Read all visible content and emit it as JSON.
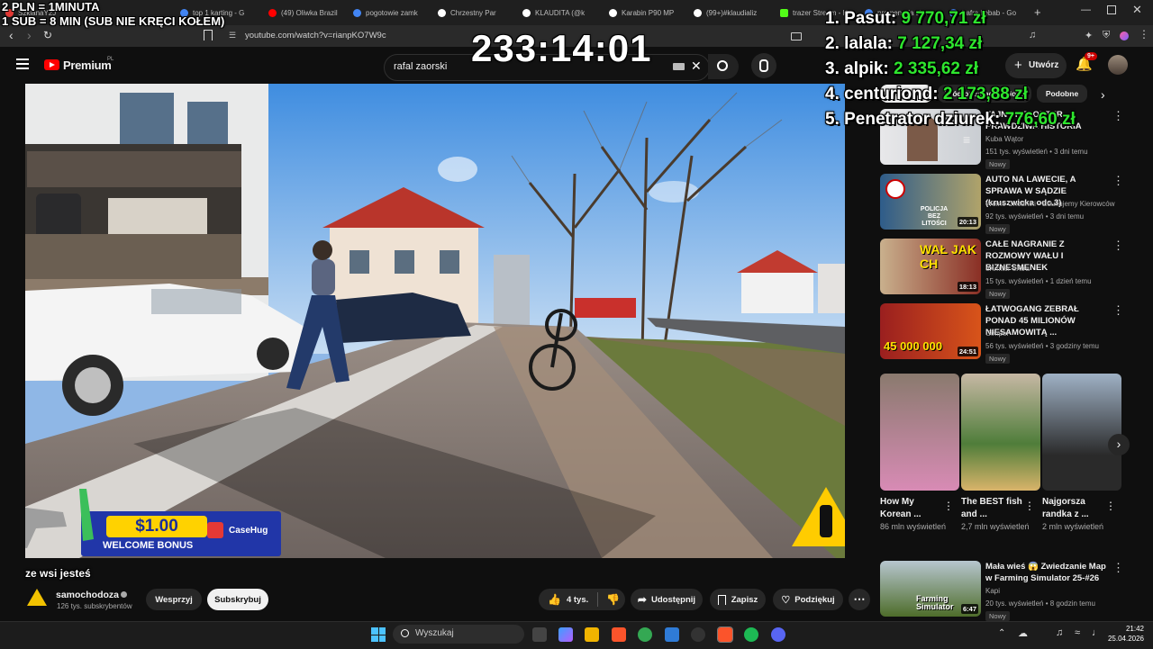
{
  "overlay": {
    "rate_line1": "2 PLN = 1MINUTA",
    "rate_line2": "1 SUB = 8 MIN (SUB NIE KRĘCI KOŁEM)",
    "timer": "233:14:01",
    "leaderboard": [
      {
        "name": "1. Pasut: ",
        "amount": "9 770,71 zł"
      },
      {
        "name": "2. lalala: ",
        "amount": "7 127,34 zł"
      },
      {
        "name": "3. alpik: ",
        "amount": "2 335,62 zł"
      },
      {
        "name": "4. centuriond: ",
        "amount": "2 173,88 zł"
      },
      {
        "name": "5. Penetrator dziurek: ",
        "amount": "776,60 zł"
      }
    ],
    "promo_amount": "$1.00",
    "promo_text": "WELCOME BONUS",
    "promo_brand": "CaseHug",
    "caption": "ze wsi jesteś"
  },
  "browser": {
    "tabs": [
      {
        "label": "SzklanaY2J",
        "color": "#e53935"
      },
      {
        "label": "top 1 karting - G",
        "color": "#4285f4"
      },
      {
        "label": "(49) Oliwka Brazil",
        "color": "#ff0000"
      },
      {
        "label": "pogotowie zamk",
        "color": "#4285f4"
      },
      {
        "label": "Chrzestny Par",
        "color": "#ffffff"
      },
      {
        "label": "KLAUDITA (@k",
        "color": "#ffffff"
      },
      {
        "label": "Karabin P90 MP",
        "color": "#ffffff"
      },
      {
        "label": "(99+)#klaudializ",
        "color": "#ffffff"
      },
      {
        "label": "trazer Stream - K",
        "color": "#53fc18"
      },
      {
        "label": "promenada sko",
        "color": "#4285f4"
      },
      {
        "label": "bafra kebab - Go",
        "color": "#4285f4"
      }
    ],
    "new_tab": "+",
    "url": "youtube.com/watch?v=rianpKO7W9c"
  },
  "youtube": {
    "logo": "Premium",
    "logo_region": "PL",
    "search_value": "rafal zaorski",
    "create_label": "Utwórz",
    "notif_count": "9+",
    "chips": [
      "Wszystko",
      "Źródło: samochodoza",
      "Podobne"
    ],
    "channel": {
      "name": "samochodoza",
      "subs": "126 tys. subskrybentów"
    },
    "actions": {
      "support": "Wesprzyj",
      "subscribe": "Subskrybuj",
      "likes": "4 tys.",
      "share": "Udostępnij",
      "save": "Zapisz",
      "thanks": "Podziękuj"
    },
    "recommended": [
      {
        "title": "TAJNY REPORTER PRAWDZIWA HISTORIA",
        "channel": "Kuba Wątor",
        "meta": "151 tys. wyświetleń • 3 dni temu",
        "badge": "Nowy",
        "duration": ""
      },
      {
        "title": "AUTO NA LAWECIE, A SPRAWA W SĄDZIE (kruszwicka odc.3)",
        "channel": "Wolne Chodniki - Edukujemy Kierowców",
        "meta": "92 tys. wyświetleń • 3 dni temu",
        "badge": "Nowy",
        "duration": "20:13",
        "thumb_text": "POLICJA BEZ LITOŚCI"
      },
      {
        "title": "CAŁE NAGRANIE Z ROZMOWY WAŁU I BIZNESMENEK",
        "channel": "eXmiter eXtra",
        "meta": "15 tys. wyświetleń • 1 dzień temu",
        "badge": "Nowy",
        "duration": "18:13",
        "thumb_text": "WAŁ JAK CH"
      },
      {
        "title": "ŁATWOGANG ZEBRAŁ PONAD 45 MILIONÓW NIESAMOWITĄ ...",
        "channel": "Gimper",
        "meta": "56 tys. wyświetleń • 3 godziny temu",
        "badge": "Nowy",
        "duration": "24:51",
        "thumb_text": "45 000 000"
      },
      {
        "title": "Mała wieś 😱 Zwiedzanie Map w Farming Simulator 25-#26",
        "channel": "Kapi",
        "meta": "20 tys. wyświetleń • 8 godzin temu",
        "badge": "Nowy",
        "duration": "6:47",
        "thumb_text": "Farming Simulator"
      }
    ],
    "shorts": [
      {
        "title": "How My Korean ...",
        "views": "86 mln wyświetleń"
      },
      {
        "title": "The BEST fish and ...",
        "views": "2,7 mln wyświetleń"
      },
      {
        "title": "Najgorsza randka z ...",
        "views": "2 mln wyświetleń"
      }
    ]
  },
  "taskbar": {
    "search_placeholder": "Wyszukaj",
    "time": "21:42",
    "date": "25.04.2026"
  },
  "colors": {
    "youtube_red": "#ff0000",
    "money_green": "#2ee62e",
    "bg": "#0f0f0f"
  }
}
